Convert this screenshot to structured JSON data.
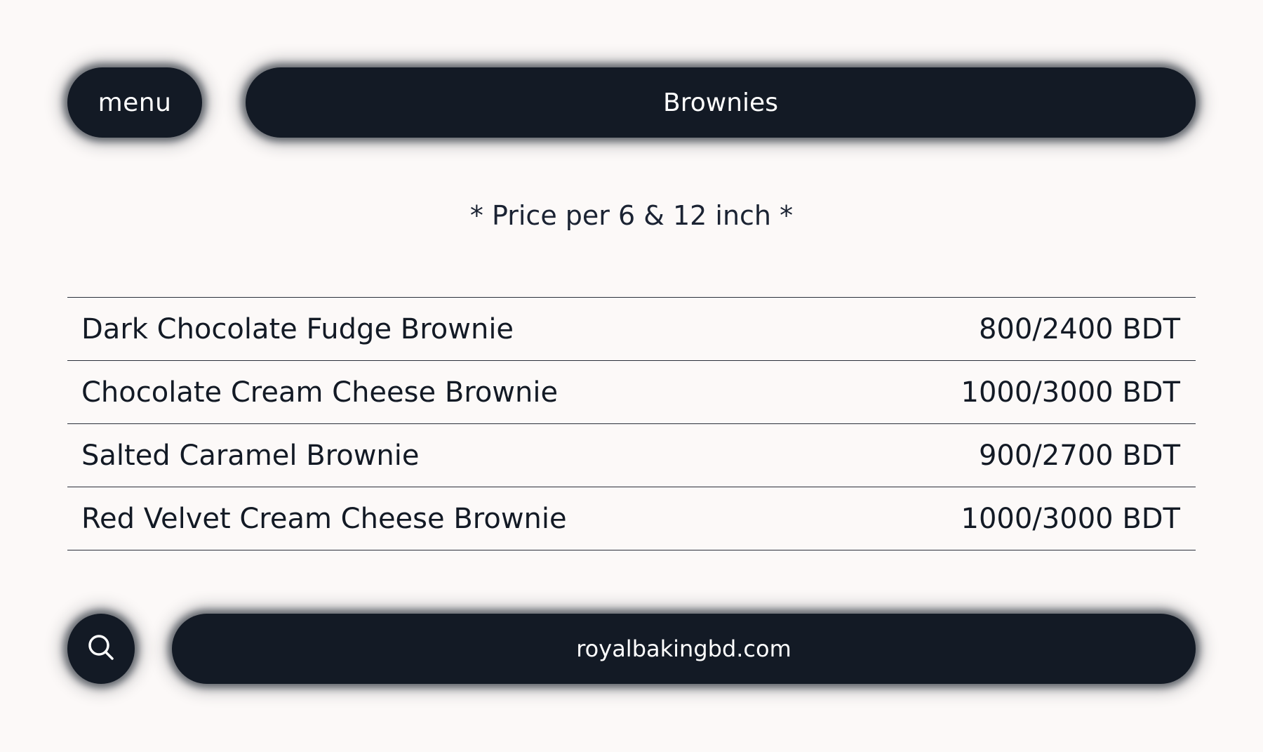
{
  "header": {
    "menu_label": "menu",
    "title": "Brownies"
  },
  "note": "* Price per 6 & 12 inch *",
  "items": [
    {
      "name": "Dark Chocolate Fudge Brownie",
      "price": "800/2400 BDT"
    },
    {
      "name": "Chocolate Cream Cheese Brownie",
      "price": "1000/3000 BDT"
    },
    {
      "name": "Salted Caramel Brownie",
      "price": "900/2700 BDT"
    },
    {
      "name": "Red Velvet Cream Cheese Brownie",
      "price": "1000/3000 BDT"
    }
  ],
  "footer": {
    "search_icon": "search-icon",
    "url": "royalbakingbd.com"
  },
  "colors": {
    "background": "#fcf9f8",
    "pill": "#131a25",
    "pill_text": "#ffffff",
    "text": "#131a25"
  }
}
